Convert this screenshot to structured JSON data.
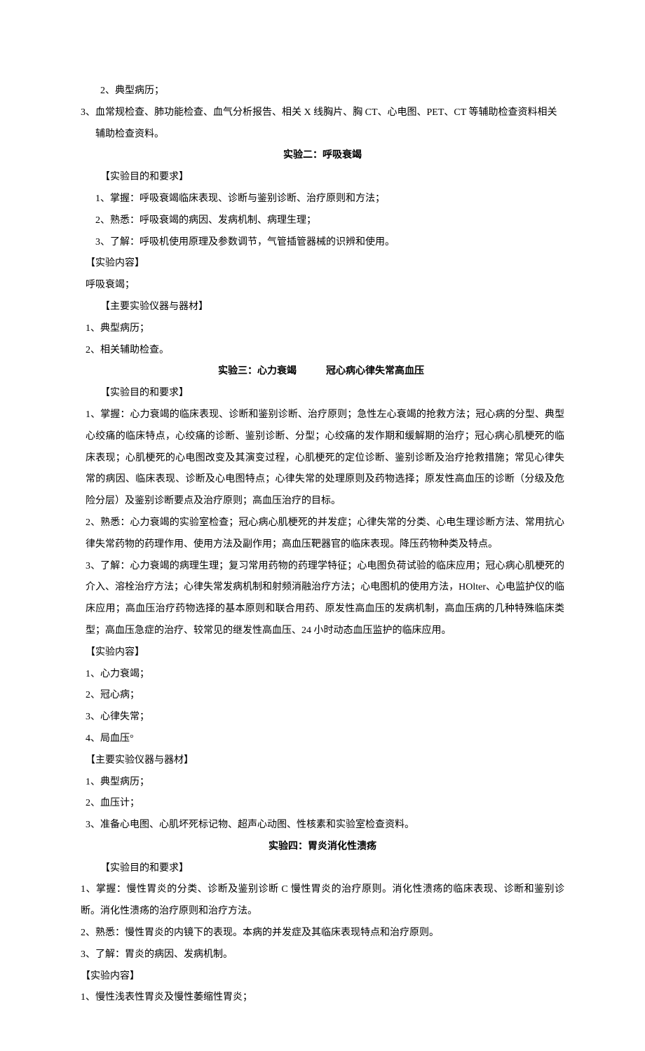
{
  "lines": {
    "l1": "2、典型病历；",
    "l2": "3、血常规检查、肺功能检查、血气分析报告、相关 X 线胸片、胸 CT、心电图、PET、CT 等辅助检查资料相关辅助检查资料。",
    "h1": "实验二：呼吸衰竭",
    "l3": "【实验目的和要求】",
    "l4": "1、掌握：呼吸衰竭临床表现、诊断与鉴别诊断、治疗原则和方法；",
    "l5": "2、熟悉：呼吸衰竭的病因、发病机制、病理生理；",
    "l6": "3、了解：呼吸机使用原理及参数调节，气管插管器械的识辨和使用。",
    "l7": "【实验内容】",
    "l8": "呼吸衰竭；",
    "l9": "【主要实验仪器与器材】",
    "l10": "1、典型病历；",
    "l11": "2、相关辅助检查。",
    "h2a": "实验三：心力衰竭",
    "h2b": "冠心病心律失常高血压",
    "l12": "【实验目的和要求】",
    "l13": "1、掌握：心力衰竭的临床表现、诊断和鉴别诊断、治疗原则；急性左心衰竭的抢救方法；冠心病的分型、典型心绞痛的临床特点，心绞痛的诊断、鉴别诊断、分型；心绞痛的发作期和缓解期的治疗；冠心病心肌梗死的临床表现；心肌梗死的心电图改变及其演变过程，心肌梗死的定位诊断、鉴别诊断及治疗抢救措施；常见心律失常的病因、临床表现、诊断及心电图特点；心律失常的处理原则及药物选择；原发性高血压的诊断（分级及危险分层）及鉴别诊断要点及治疗原则；高血压治疗的目标。",
    "l14": "2、熟悉：心力衰竭的实验室检查；冠心病心肌梗死的并发症；心律失常的分类、心电生理诊断方法、常用抗心律失常药物的药理作用、使用方法及副作用；高血压靶器官的临床表现。降压药物种类及特点。",
    "l15": "3、了解：心力衰竭的病理生理；复习常用药物的药理学特征；心电图负荷试验的临床应用；冠心病心肌梗死的介入、溶栓治疗方法；心律失常发病机制和射频消融治疗方法；心电图机的使用方法，HOlter、心电监护仪的临床应用；高血压治疗药物选择的基本原则和联合用药、原发性高血压的发病机制，高血压病的几种特殊临床类型；高血压急症的治疗、较常见的继发性高血压、24 小时动态血压监护的临床应用。",
    "l16": "【实验内容】",
    "l17": "1、心力衰竭；",
    "l18": "2、冠心病；",
    "l19": "3、心律失常；",
    "l20": "4、局血压°",
    "l21": "【主要实验仪器与器材】",
    "l22": "1、典型病历；",
    "l23": "2、血压计；",
    "l24": "3、准备心电图、心肌坏死标记物、超声心动图、性核素和实验室检查资料。",
    "h3": "实验四：胃炎消化性溃疡",
    "l25": "【实验目的和要求】",
    "l26": "1、掌握：慢性胃炎的分类、诊断及鉴别诊断 C 慢性胃炎的治疗原则。消化性溃疡的临床表现、诊断和鉴别诊断。消化性溃疡的治疗原则和治疗方法。",
    "l27": "2、熟悉：慢性胃炎的内镜下的表现。本病的并发症及其临床表现特点和治疗原则。",
    "l28": "3、了解：胃炎的病因、发病机制。",
    "l29": "【实验内容】",
    "l30": "1、慢性浅表性胃炎及慢性萎缩性胃炎；"
  }
}
